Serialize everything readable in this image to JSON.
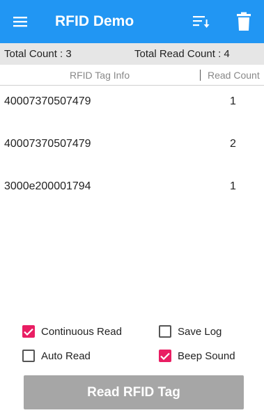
{
  "app": {
    "title": "RFID Demo",
    "accent_color": "#2196F3",
    "icons": {
      "menu": "hamburger-menu-icon",
      "sort": "sort-icon",
      "delete": "trash-icon"
    }
  },
  "counts": {
    "total_count": "Total Count : 3",
    "total_read_count": "Total Read Count : 4"
  },
  "table": {
    "columns": [
      "RFID Tag Info",
      "Read Count"
    ],
    "rows": [
      {
        "tag": "40007370507479",
        "count": "1"
      },
      {
        "tag": "40007370507479",
        "count": "2"
      },
      {
        "tag": "3000e200001794",
        "count": "1"
      }
    ]
  },
  "options": {
    "continuous_read": {
      "label": "Continuous Read",
      "checked": true
    },
    "save_log": {
      "label": "Save Log",
      "checked": false
    },
    "auto_read": {
      "label": "Auto Read",
      "checked": false
    },
    "beep_sound": {
      "label": "Beep Sound",
      "checked": true
    },
    "check_color": "#E91E63"
  },
  "read_button": {
    "label": "Read RFID Tag"
  }
}
